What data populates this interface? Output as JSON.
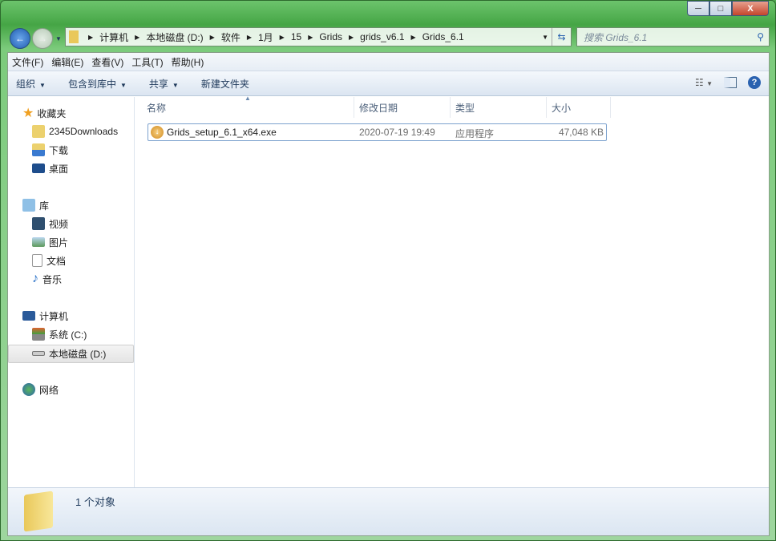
{
  "window": {
    "minimize": "─",
    "maximize": "□",
    "close": "X"
  },
  "address": {
    "crumbs": [
      "计算机",
      "本地磁盘 (D:)",
      "软件",
      "1月",
      "15",
      "Grids",
      "grids_v6.1",
      "Grids_6.1"
    ]
  },
  "search": {
    "placeholder": "搜索 Grids_6.1"
  },
  "menu": [
    "文件(F)",
    "编辑(E)",
    "查看(V)",
    "工具(T)",
    "帮助(H)"
  ],
  "toolbar": {
    "organize": "组织",
    "include": "包含到库中",
    "share": "共享",
    "new_folder": "新建文件夹"
  },
  "sidebar": {
    "favorites": "收藏夹",
    "fav_items": [
      "2345Downloads",
      "下载",
      "桌面"
    ],
    "libraries": "库",
    "lib_items": [
      "视频",
      "图片",
      "文档",
      "音乐"
    ],
    "computer": "计算机",
    "drives": [
      "系统 (C:)",
      "本地磁盘 (D:)"
    ],
    "network": "网络"
  },
  "columns": [
    "名称",
    "修改日期",
    "类型",
    "大小"
  ],
  "files": [
    {
      "name": "Grids_setup_6.1_x64.exe",
      "date": "2020-07-19 19:49",
      "type": "应用程序",
      "size": "47,048 KB"
    }
  ],
  "status": {
    "count": "1 个对象"
  }
}
